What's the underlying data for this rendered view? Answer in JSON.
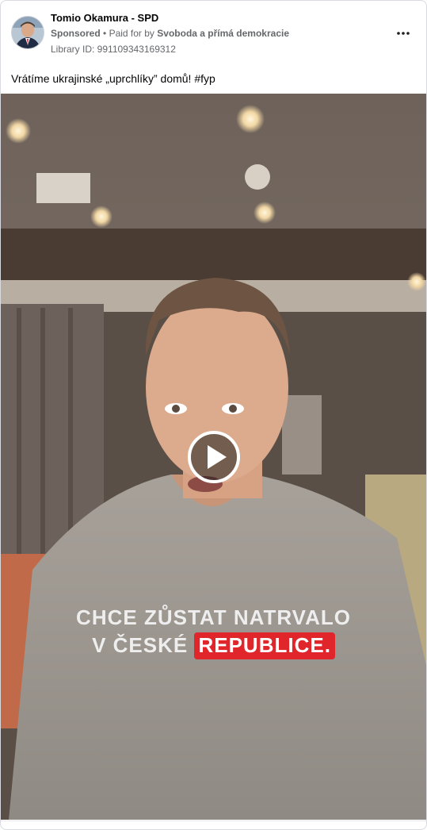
{
  "post": {
    "page_name": "Tomio Okamura - SPD",
    "sponsored_label": "Sponsored",
    "separator": "•",
    "paid_for_prefix": "Paid for by",
    "payer": "Svoboda a přímá demokracie",
    "library_id": "Library ID: 991109343169312",
    "text": "Vrátíme ukrajinské „uprchlíky” domů! #fyp"
  },
  "icons": {
    "more": "more-horizontal-icon",
    "play": "play-icon"
  },
  "video": {
    "caption_line1": "CHCE ZŮSTAT NATRVALO",
    "caption_line2_prefix": "V ČESKÉ",
    "caption_line2_highlight": "REPUBLICE."
  },
  "colors": {
    "caption_highlight": "#e0262b",
    "secondary_text": "#65676b",
    "primary_text": "#050505"
  }
}
